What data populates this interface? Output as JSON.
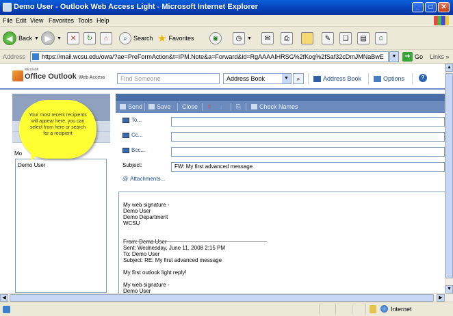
{
  "window": {
    "title": "Demo User - Outlook Web Access Light - Microsoft Internet Explorer",
    "minimize": "_",
    "maximize": "□",
    "close": "✕"
  },
  "menu": [
    "File",
    "Edit",
    "View",
    "Favorites",
    "Tools",
    "Help"
  ],
  "toolbar": {
    "back": "Back",
    "search": "Search",
    "favorites": "Favorites"
  },
  "address": {
    "label": "Address",
    "url": "https://mail.wcsu.edu/owa/?ae=PreFormAction&t=IPM.Note&a=Forward&id=RgAAAAIHRSG%2fKog%2fSaf32cDmJMNaBwE",
    "go": "Go",
    "links": "Links »"
  },
  "owa": {
    "microsoft": "Microsoft",
    "product": "Office Outlook",
    "product_suffix": "Web Access",
    "find_placeholder": "Find Someone",
    "address_book_select": "Address Book",
    "address_book_link": "Address Book",
    "options": "Options"
  },
  "compose": {
    "send": "Send",
    "save": "Save",
    "close": "Close",
    "check_names": "Check Names",
    "to_label": "To...",
    "cc_label": "Cc...",
    "bcc_label": "Bcc...",
    "subject_label": "Subject:",
    "subject_value": "FW: My first advanced message",
    "attachments": "Attachments...",
    "body": "My web signature -\nDemo User\nDemo Department\nWCSU\n\n\nFrom: Demo User\nSent: Wednesday, June 11, 2008 2:15 PM\nTo: Demo User\nSubject: RE: My first advanced message\n\nMy first outlook light reply!\n\nMy web signature -\nDemo User"
  },
  "left": {
    "most_recent_label": "Mo",
    "recent_item": "Demo User"
  },
  "callout": {
    "text": "Your most recent recipients will appear here, you can select from here or search for a recipient"
  },
  "status": {
    "zone": "Internet"
  }
}
